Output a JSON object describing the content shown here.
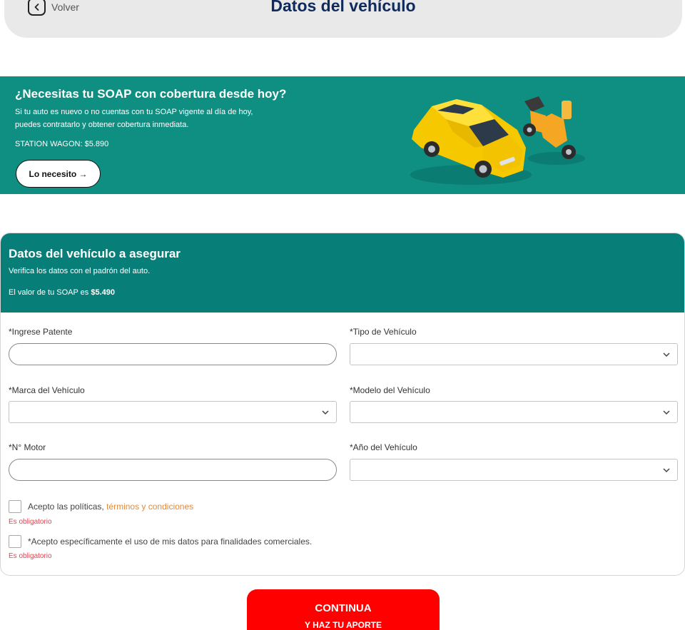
{
  "header": {
    "back_label": "Volver",
    "title": "Datos del vehículo"
  },
  "promo": {
    "title": "¿Necesitas tu SOAP con cobertura desde hoy?",
    "text_line1": "Si tu auto es nuevo o no cuentas con tu SOAP vigente al día de hoy,",
    "text_line2": "puedes contratarlo y obtener cobertura inmediata.",
    "price": "STATION WAGON: $5.890",
    "button_label": "Lo necesito →"
  },
  "form": {
    "title": "Datos del vehículo a asegurar",
    "subtitle": "Verifica los datos con el padrón del auto.",
    "value_prefix": "El valor de tu SOAP es",
    "value_amount": "$5.490",
    "fields": {
      "patente": {
        "label": "*Ingrese Patente",
        "value": ""
      },
      "tipo": {
        "label": "*Tipo de Vehículo",
        "value": ""
      },
      "marca": {
        "label": "*Marca del Vehículo",
        "value": ""
      },
      "modelo": {
        "label": "*Modelo del Vehículo",
        "value": ""
      },
      "motor": {
        "label": "*N° Motor",
        "value": ""
      },
      "anio": {
        "label": "*Año del Vehículo",
        "value": ""
      }
    },
    "check1": {
      "text": "Acepto las políticas,",
      "link": "términos y condiciones",
      "error": "Es obligatorio"
    },
    "check2": {
      "text": "*Acepto específicamente el uso de mis datos para finalidades comerciales.",
      "error": "Es obligatorio"
    }
  },
  "continue": {
    "line1": "CONTINUA",
    "line2": "Y HAZ TU APORTE"
  },
  "colors": {
    "teal_banner": "#0e8f82",
    "teal_card": "#087e78",
    "title_navy": "#0f2a5c",
    "cta_red": "#ff0000",
    "link_orange": "#e08a3c",
    "error_red": "#e3424f"
  },
  "icons": {
    "back": "chevron-left-icon",
    "select": "chevron-down-icon"
  }
}
